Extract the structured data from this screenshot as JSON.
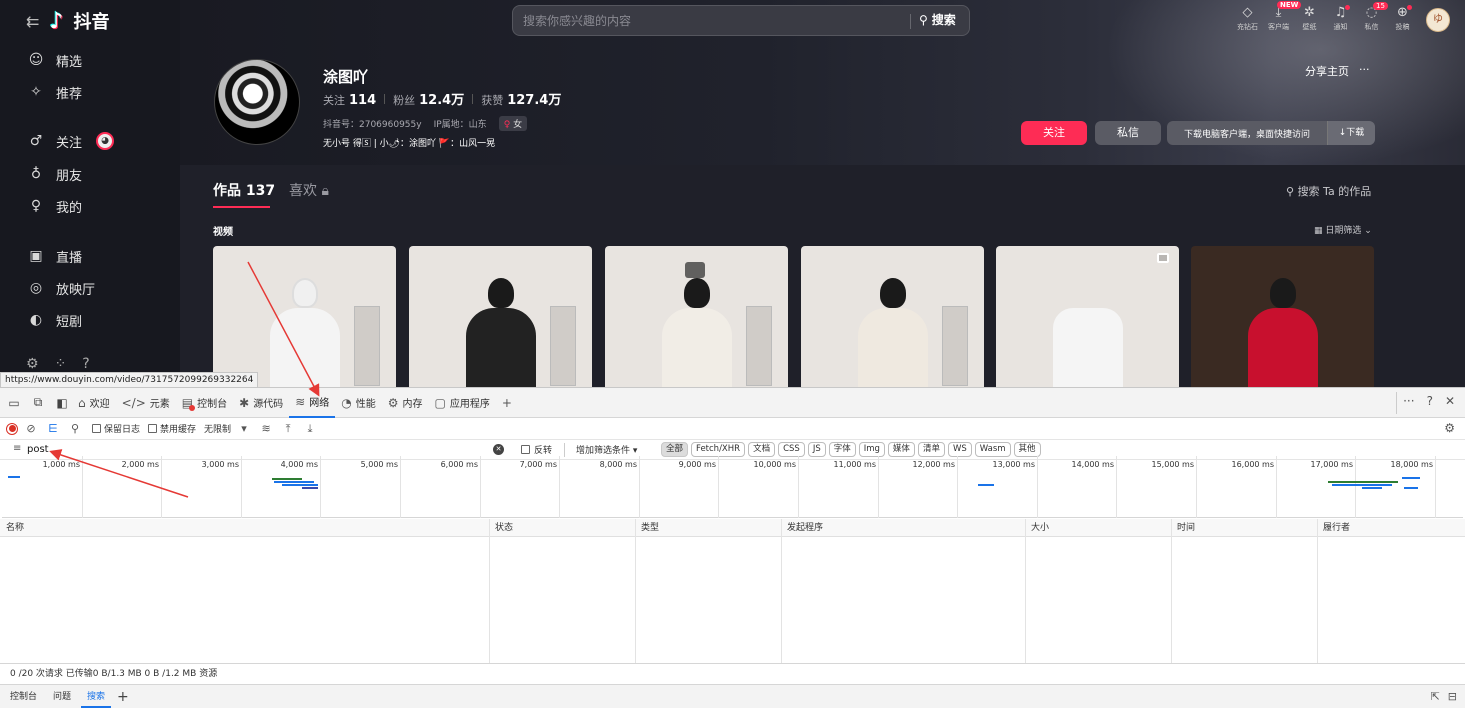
{
  "app": {
    "logo_text": "抖音",
    "search": {
      "placeholder": "搜索你感兴趣的内容",
      "button": "搜索"
    },
    "top_icons": [
      {
        "icon": "diamond-icon",
        "label": "充钻石",
        "badge": ""
      },
      {
        "icon": "download-icon",
        "label": "客户端",
        "badge": "NEW"
      },
      {
        "icon": "wallpaper-icon",
        "label": "壁纸",
        "badge": ""
      },
      {
        "icon": "bell-icon",
        "label": "通知",
        "badge": "dot"
      },
      {
        "icon": "message-icon",
        "label": "私信",
        "badge": "15"
      },
      {
        "icon": "upload-icon",
        "label": "投稿",
        "badge": "dot"
      }
    ],
    "user_avatar_text": "ゆ"
  },
  "sidebar": {
    "items": [
      {
        "icon": "featured-icon",
        "label": "精选"
      },
      {
        "icon": "recommend-icon",
        "label": "推荐"
      },
      {
        "icon": "follow-icon",
        "label": "关注"
      },
      {
        "icon": "friends-icon",
        "label": "朋友"
      },
      {
        "icon": "me-icon",
        "label": "我的"
      },
      {
        "icon": "live-icon",
        "label": "直播"
      },
      {
        "icon": "cinema-icon",
        "label": "放映厅"
      },
      {
        "icon": "drama-icon",
        "label": "短剧"
      }
    ]
  },
  "profile": {
    "name": "涂图吖",
    "following_label": "关注",
    "following": "114",
    "fans_label": "粉丝",
    "fans": "12.4万",
    "likes_label": "获赞",
    "likes": "127.4万",
    "douyin_id": "抖音号：2706960955y",
    "ip": "IP属地：山东",
    "gender": "女",
    "bio": "无小号 得🅂 | 小🌶：涂图吖 🚩：山风一晃",
    "share": "分享主页",
    "more": "···",
    "follow_btn": "关注",
    "msg_btn": "私信",
    "download_tip": "下载电脑客户端，桌面快捷访问",
    "download_btn": "↓下载",
    "tab_works": "作品 137",
    "tab_likes": "喜欢",
    "search_works": "搜索 Ta 的作品",
    "section_label": "视频",
    "date_filter": "日期筛选"
  },
  "thumb_colors": [
    "#f4f4f4",
    "#222222",
    "#f1ede6",
    "#efe9e0",
    "#f5f5f5",
    "#c8102e"
  ],
  "status_url": "https://www.douyin.com/video/7317572099269332264",
  "devtools": {
    "tabs": [
      {
        "icon": "home-icon",
        "label": "欢迎"
      },
      {
        "icon": "code-icon",
        "label": "元素"
      },
      {
        "icon": "console-icon",
        "label": "控制台"
      },
      {
        "icon": "bug-icon",
        "label": "源代码"
      },
      {
        "icon": "wifi-icon",
        "label": "网络"
      },
      {
        "icon": "performance-icon",
        "label": "性能"
      },
      {
        "icon": "memory-icon",
        "label": "内存"
      },
      {
        "icon": "application-icon",
        "label": "应用程序"
      }
    ],
    "active_tab": "网络",
    "toolbar": {
      "preserve_log": "保留日志",
      "disable_cache": "禁用缓存",
      "throttle": "无限制"
    },
    "filter": {
      "value": "post",
      "invert": "反转",
      "more_filters": "增加筛选条件",
      "types": [
        "全部",
        "Fetch/XHR",
        "文档",
        "CSS",
        "JS",
        "字体",
        "Img",
        "媒体",
        "清单",
        "WS",
        "Wasm",
        "其他"
      ]
    },
    "timeline_ticks": [
      "1,000 ms",
      "2,000 ms",
      "3,000 ms",
      "4,000 ms",
      "5,000 ms",
      "6,000 ms",
      "7,000 ms",
      "8,000 ms",
      "9,000 ms",
      "10,000 ms",
      "11,000 ms",
      "12,000 ms",
      "13,000 ms",
      "14,000 ms",
      "15,000 ms",
      "16,000 ms",
      "17,000 ms",
      "18,000 ms"
    ],
    "columns": [
      "名称",
      "状态",
      "类型",
      "发起程序",
      "大小",
      "时间",
      "履行者"
    ],
    "summary": "0 /20 次请求  已传输0 B/1.3 MB  0 B /1.2 MB 资源",
    "drawer_tabs": [
      "控制台",
      "问题",
      "搜索"
    ],
    "drawer_active": "搜索"
  }
}
